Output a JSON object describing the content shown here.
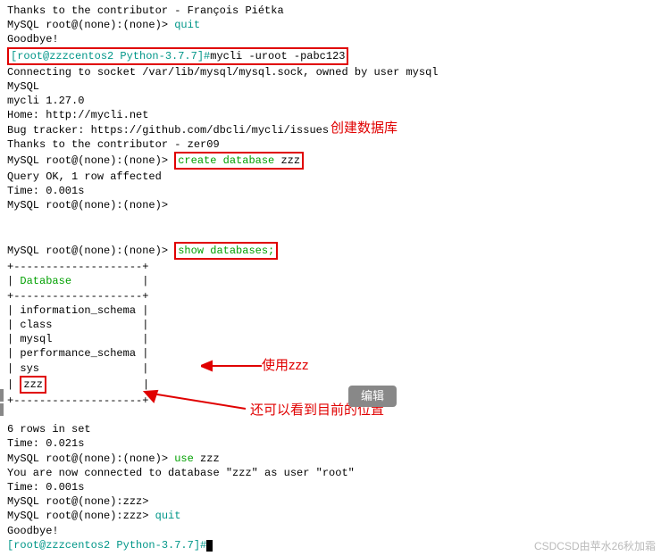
{
  "l0": "Thanks to the contributor - François Piétka",
  "l1a": "MySQL root@(none):(none)> ",
  "l1b": "quit",
  "l2": "Goodbye!",
  "l3a": "[root@zzzcentos2 Python-3.7.7]#",
  "l3b": "mycli -uroot -pabc123",
  "l4": "Connecting to socket /var/lib/mysql/mysql.sock, owned by user mysql",
  "l5": "MySQL",
  "l6": "mycli 1.27.0",
  "l7": "Home: http://mycli.net",
  "l8": "Bug tracker: https://github.com/dbcli/mycli/issues",
  "l9": "Thanks to the contributor - zer09",
  "l10a": "MySQL root@(none):(none)>",
  "l10b": "create database",
  "l10c": " zzz",
  "annot1": "创建数据库",
  "l11": "Query OK, 1 row affected",
  "l12": "Time: 0.001s",
  "l13": "MySQL root@(none):(none)>",
  "l14a": "MySQL root@(none):(none)>",
  "l14b": "show databases;",
  "sep": "+--------------------+",
  "dbhdr": "Database",
  "db1": "| information_schema |",
  "db2": "| class              |",
  "db3": "| mysql              |",
  "db4": "| performance_schema |",
  "db5": "| sys                |",
  "db6a": "|",
  "db6b": "zzz",
  "db6c": "               |",
  "l20": "6 rows in set",
  "l21": "Time: 0.021s",
  "l22a": "MySQL root@(none):(none)> ",
  "l22b": "use",
  "l22c": " zzz",
  "annot2": "使用zzz",
  "l23": "You are now connected to database \"zzz\" as user \"root\"",
  "l24": "Time: 0.001s",
  "l25": "MySQL root@(none):zzz>",
  "edit": "编辑",
  "l26a": "MySQL root@(none):zzz> ",
  "l26b": "quit",
  "annot3": "还可以看到目前的位置",
  "l27": "Goodbye!",
  "l28": "[root@zzzcentos2 Python-3.7.7]#",
  "wm": "CSDCSD由苹水26秋加霜"
}
